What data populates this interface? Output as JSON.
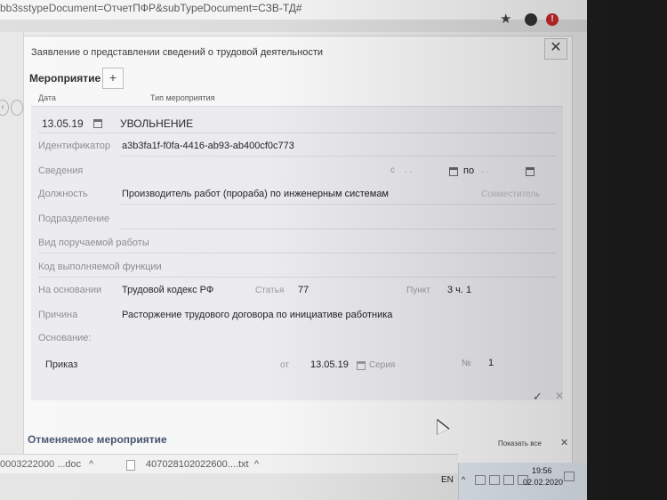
{
  "browser": {
    "url": "bb3sstypeDocument=ОтчетПФР&subTypeDocument=СЗВ-ТД#",
    "alert_glyph": "!"
  },
  "background_page": {
    "nav_glyph": "‹"
  },
  "dialog": {
    "title": "Заявление о представлении сведений о трудовой деятельности",
    "close_glyph": "✕",
    "section_title": "Мероприятие",
    "add_glyph": "+",
    "col_date": "Дата",
    "col_event_type": "Тип мероприятия",
    "date": "13.05.19",
    "event_type": "УВОЛЬНЕНИЕ",
    "identifier_label": "Идентификатор",
    "identifier_value": "a3b3fa1f-f0fa-4416-ab93-ab400cf0c773",
    "info_label": "Сведения",
    "from_label": "с",
    "from_value": ". .",
    "to_label": "по",
    "to_value": ". .",
    "position_label": "Должность",
    "position_value": "Производитель работ (прораба) по инженерным системам",
    "part_time_label": "Совместитель",
    "department_label": "Подразделение",
    "work_type_label": "Вид поручаемой работы",
    "function_code_label": "Код выполняемой функции",
    "basis_label": "На основании",
    "basis_value": "Трудовой кодекс РФ",
    "article_label": "Статья",
    "article_value": "77",
    "point_label": "Пункт",
    "point_value": "3 ч. 1",
    "reason_label": "Причина",
    "reason_value": "Расторжение трудового договора по инициативе работника",
    "grounds_label": "Основание:",
    "doc_name": "Приказ",
    "doc_from_label": "от",
    "doc_date": "13.05.19",
    "doc_series_label": "Серия",
    "doc_number_label": "№",
    "doc_number": "1",
    "confirm_glyph": "✓",
    "cancel_glyph": "✕",
    "cancelled_event_title": "Отменяемое мероприятие",
    "show_all_label": "Показать все",
    "show_all_close": "✕"
  },
  "downloads": {
    "item1": "0003222000 ...doc",
    "item1_chevron": "^",
    "item2": "407028102022600....txt",
    "item2_chevron": "^"
  },
  "taskbar": {
    "language": "EN",
    "tray_chevron": "^",
    "time": "19:56",
    "date": "02.02.2020"
  }
}
